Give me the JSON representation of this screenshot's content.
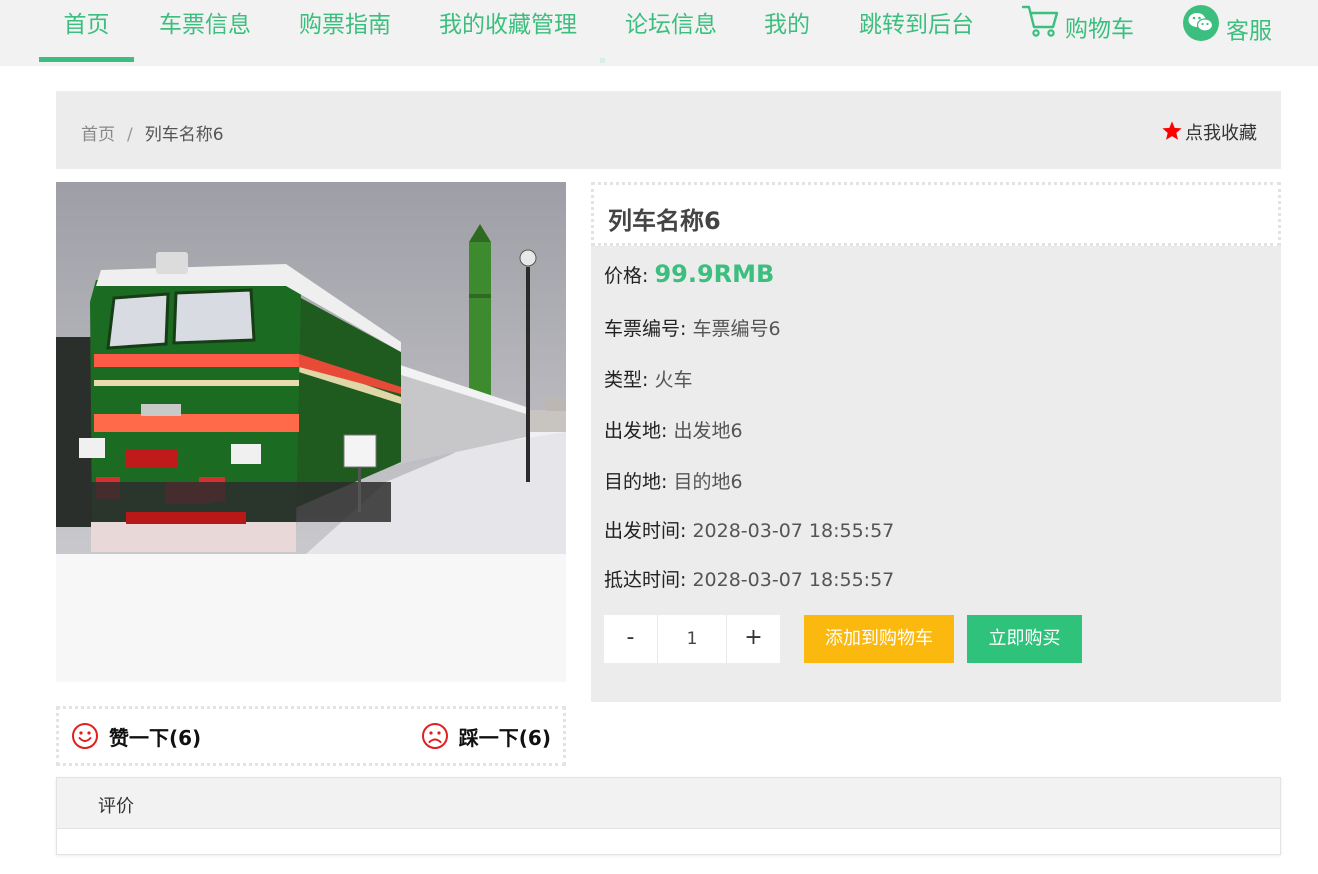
{
  "nav": {
    "items": [
      {
        "label": "首页",
        "active": true
      },
      {
        "label": "车票信息"
      },
      {
        "label": "购票指南"
      },
      {
        "label": "我的收藏管理"
      },
      {
        "label": "论坛信息"
      },
      {
        "label": "我的"
      },
      {
        "label": "跳转到后台"
      }
    ],
    "cart": {
      "label": "购物车",
      "icon": "shopping-cart-icon"
    },
    "service": {
      "label": "客服",
      "icon": "wechat-icon"
    },
    "accent_color": "#3cbf7e"
  },
  "breadcrumb": {
    "home": "首页",
    "separator": "/",
    "current": "列车名称6"
  },
  "favorite": {
    "label": "点我收藏",
    "icon": "star-icon",
    "color": "#ff0000"
  },
  "product": {
    "title": "列车名称6",
    "fields": [
      {
        "label": "价格:",
        "value": "99.9RMB"
      },
      {
        "label": "车票编号:",
        "value": "车票编号6"
      },
      {
        "label": "类型:",
        "value": "火车"
      },
      {
        "label": "出发地:",
        "value": "出发地6"
      },
      {
        "label": "目的地:",
        "value": "目的地6"
      },
      {
        "label": "出发时间:",
        "value": "2028-03-07 18:55:57"
      },
      {
        "label": "抵达时间:",
        "value": "2028-03-07 18:55:57"
      }
    ],
    "image_icon": "train-photo"
  },
  "quantity": {
    "minus": "-",
    "value": "1",
    "plus": "+"
  },
  "actions": {
    "add_to_cart": "添加到购物车",
    "buy_now": "立即购买",
    "cart_color": "#fbb80f",
    "buy_color": "#2fc27b"
  },
  "votes": {
    "like": "赞一下(6)",
    "dislike": "踩一下(6)",
    "like_icon": "smile-icon",
    "dislike_icon": "frown-icon"
  },
  "review": {
    "tab": "评价"
  }
}
